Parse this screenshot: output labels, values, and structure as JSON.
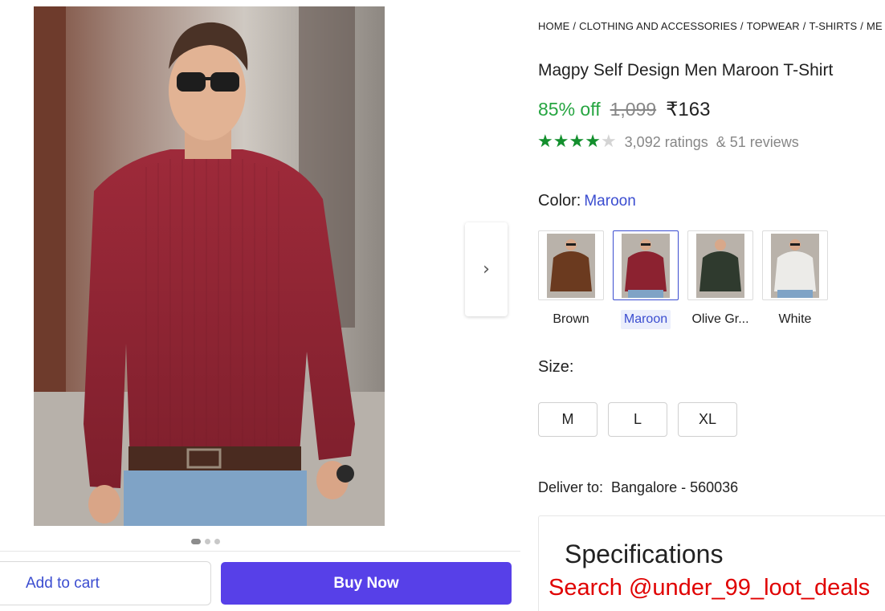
{
  "breadcrumb": [
    "HOME",
    "CLOTHING AND ACCESSORIES",
    "TOPWEAR",
    "T-SHIRTS",
    "ME"
  ],
  "product": {
    "title": "Magpy Self Design Men Maroon T-Shirt",
    "discount": "85% off",
    "mrp": "1,099",
    "price": "₹163",
    "rating_value": 4,
    "rating_max": 5,
    "ratings_text": "3,092 ratings",
    "reviews_text": "& 51 reviews"
  },
  "color": {
    "label": "Color:",
    "selected": "Maroon",
    "options": [
      {
        "name": "Brown",
        "swatch": "#6b3a1f"
      },
      {
        "name": "Maroon",
        "swatch": "#8c2230"
      },
      {
        "name": "Olive Gr...",
        "swatch": "#2f3a2e"
      },
      {
        "name": "White",
        "swatch": "#ecebe8"
      }
    ]
  },
  "size": {
    "label": "Size:",
    "options": [
      "M",
      "L",
      "XL"
    ]
  },
  "delivery": {
    "label": "Deliver to:",
    "location": "Bangalore - 560036"
  },
  "specs": {
    "title": "Specifications"
  },
  "promo_text": "Search @under_99_loot_deals",
  "carousel": {
    "count": 3,
    "active": 0
  },
  "actions": {
    "add_to_cart": "Add to cart",
    "buy_now": "Buy Now"
  },
  "colors": {
    "accent": "#5740e8",
    "link": "#3b4dd0",
    "discount_green": "#26a541",
    "star_green": "#138f2d",
    "promo_red": "#e00000"
  },
  "icons": {
    "next": "chevron-right-icon",
    "star": "star-icon"
  }
}
